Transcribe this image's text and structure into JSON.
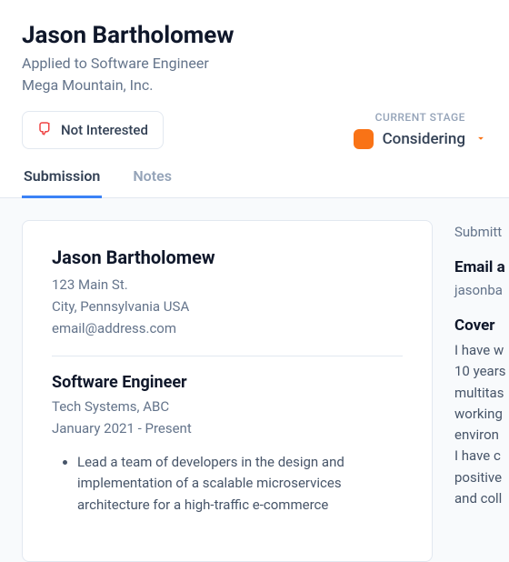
{
  "header": {
    "name": "Jason Bartholomew",
    "applied": "Applied to Software Engineer",
    "company": "Mega Mountain, Inc."
  },
  "controls": {
    "not_interested": "Not Interested",
    "stage_label": "CURRENT STAGE",
    "stage_value": "Considering",
    "stage_color": "#f97316"
  },
  "tabs": {
    "submission": "Submission",
    "notes": "Notes"
  },
  "resume": {
    "name": "Jason Bartholomew",
    "addr1": "123 Main St.",
    "addr2": "City, Pennsylvania USA",
    "email": "email@address.com",
    "job_title": "Software Engineer",
    "job_company": "Tech Systems, ABC",
    "job_dates": "January 2021 - Present",
    "bullet1": "Lead a team of developers in the design and implementation of a scalable microservices architecture for a high-traffic e-commerce"
  },
  "side": {
    "submitted": "Submitt",
    "email_h": "Email a",
    "email_v": "jasonba",
    "cover_h": "Cover",
    "cover_p": "I have w\n10 years\nmultitas\nworking\nenviron\nI have c\npositive\nand coll"
  }
}
